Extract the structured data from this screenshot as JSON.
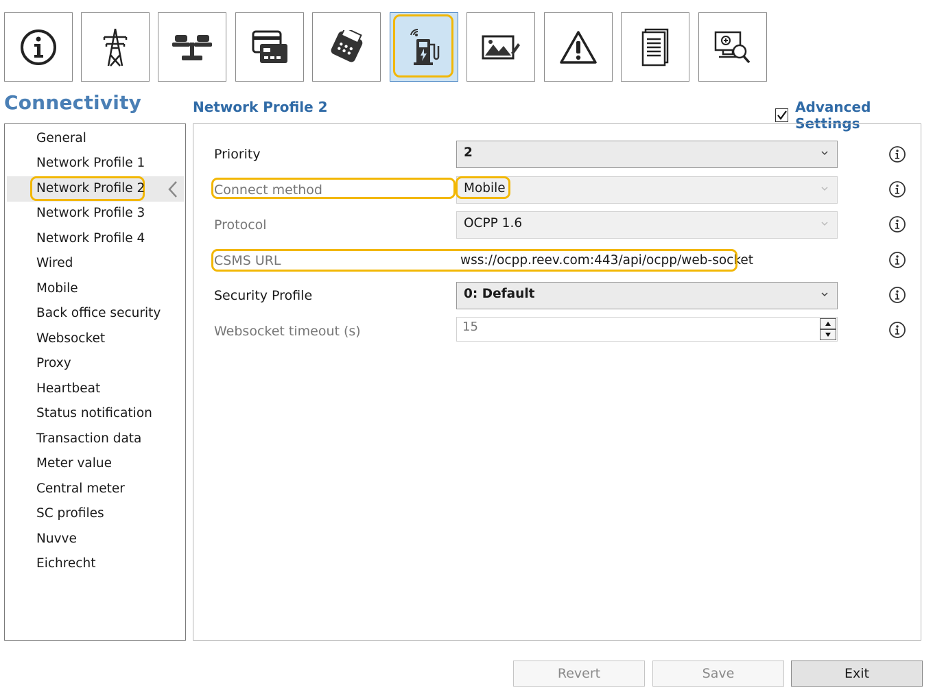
{
  "toolbar": {
    "buttons": [
      {
        "icon": "info-icon"
      },
      {
        "icon": "power-tower-icon"
      },
      {
        "icon": "scale-icon"
      },
      {
        "icon": "card-reader-icon"
      },
      {
        "icon": "payment-terminal-icon"
      },
      {
        "icon": "connectivity-charger-icon",
        "active": true
      },
      {
        "icon": "image-edit-icon"
      },
      {
        "icon": "warning-icon"
      },
      {
        "icon": "document-icon"
      },
      {
        "icon": "diagnostics-icon"
      }
    ]
  },
  "section_title": "Connectivity",
  "page_title": "Network Profile 2",
  "advanced_settings": {
    "label": "Advanced Settings",
    "checked": true
  },
  "nav": {
    "items": [
      {
        "label": "General"
      },
      {
        "label": "Network Profile 1"
      },
      {
        "label": "Network Profile 2",
        "selected": true
      },
      {
        "label": "Network Profile 3"
      },
      {
        "label": "Network Profile 4"
      },
      {
        "label": "Wired"
      },
      {
        "label": "Mobile"
      },
      {
        "label": "Back office security"
      },
      {
        "label": "Websocket"
      },
      {
        "label": "Proxy"
      },
      {
        "label": "Heartbeat"
      },
      {
        "label": "Status notification"
      },
      {
        "label": "Transaction data"
      },
      {
        "label": "Meter value"
      },
      {
        "label": "Central meter"
      },
      {
        "label": "SC profiles"
      },
      {
        "label": "Nuvve"
      },
      {
        "label": "Eichrecht"
      }
    ]
  },
  "form": {
    "priority": {
      "label": "Priority",
      "value": "2"
    },
    "connect_method": {
      "label": "Connect method",
      "value": "Mobile"
    },
    "protocol": {
      "label": "Protocol",
      "value": "OCPP 1.6"
    },
    "csms_url": {
      "label": "CSMS URL",
      "value": "wss://ocpp.reev.com:443/api/ocpp/web-socket"
    },
    "security_profile": {
      "label": "Security Profile",
      "value": "0: Default"
    },
    "websocket_timeout": {
      "label": "Websocket timeout (s)",
      "value": "15"
    }
  },
  "footer": {
    "revert": "Revert",
    "save": "Save",
    "exit": "Exit"
  },
  "colors": {
    "accent": "#2f6aa6",
    "highlight": "#f2b705",
    "active_tab": "#cde3f3"
  }
}
